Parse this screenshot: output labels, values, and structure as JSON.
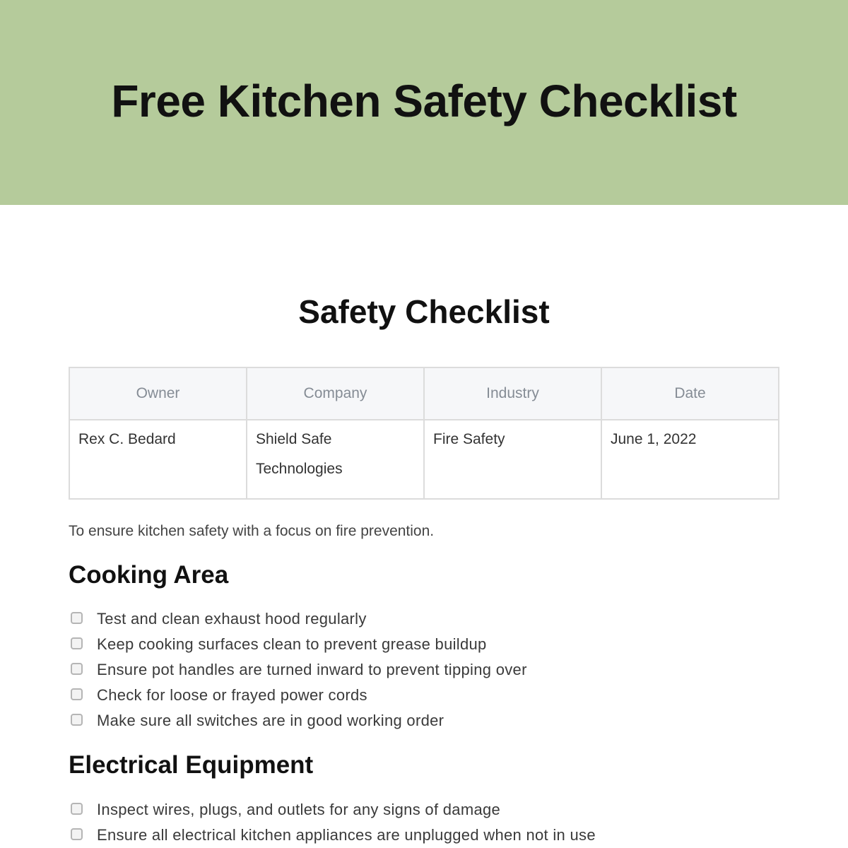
{
  "banner": {
    "title": "Free Kitchen Safety Checklist",
    "background": "#b5cb9b"
  },
  "document": {
    "title": "Safety Checklist",
    "info_table": {
      "headers": [
        "Owner",
        "Company",
        "Industry",
        "Date"
      ],
      "values": [
        "Rex C. Bedard",
        "Shield Safe Technologies",
        "Fire Safety",
        "June 1, 2022"
      ]
    },
    "intro": "To ensure kitchen safety with a focus on fire prevention.",
    "sections": [
      {
        "heading": "Cooking Area",
        "items": [
          {
            "label": "Test and clean exhaust hood regularly",
            "checked": false
          },
          {
            "label": "Keep cooking surfaces clean to prevent grease buildup",
            "checked": false
          },
          {
            "label": "Ensure pot handles are turned inward to prevent tipping over",
            "checked": false
          },
          {
            "label": "Check for loose or frayed power cords",
            "checked": false
          },
          {
            "label": "Make sure all switches are in good working order",
            "checked": false
          }
        ]
      },
      {
        "heading": "Electrical Equipment",
        "items": [
          {
            "label": "Inspect wires, plugs, and outlets for any signs of damage",
            "checked": false
          },
          {
            "label": "Ensure all electrical kitchen appliances are unplugged when not in use",
            "checked": false
          }
        ]
      }
    ]
  }
}
